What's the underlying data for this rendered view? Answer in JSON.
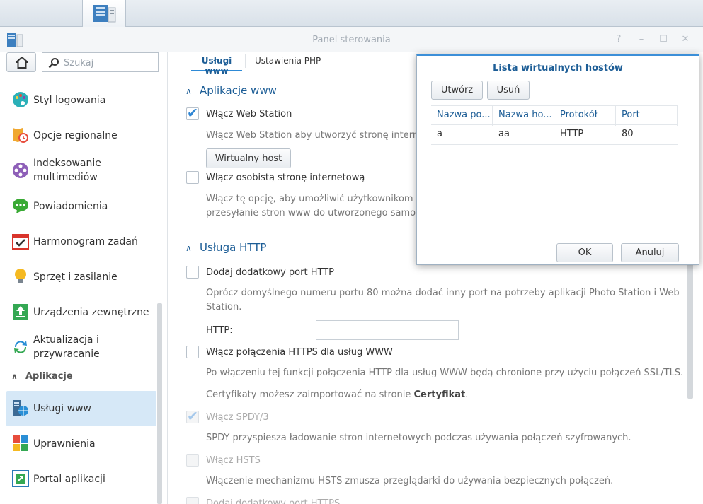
{
  "window": {
    "title": "Panel sterowania",
    "controls": [
      "?",
      "–",
      "☐",
      "✕"
    ]
  },
  "search": {
    "placeholder": "Szukaj"
  },
  "sidebar": {
    "items": [
      {
        "label": "Styl logowania",
        "icon": "palette-icon"
      },
      {
        "label": "Opcje regionalne",
        "icon": "regional-clock-icon"
      },
      {
        "label": "Indeksowanie\nmultimediów",
        "icon": "media-indexing-icon"
      },
      {
        "label": "Powiadomienia",
        "icon": "chat-bubble-icon"
      },
      {
        "label": "Harmonogram zadań",
        "icon": "calendar-check-icon"
      },
      {
        "label": "Sprzęt i zasilanie",
        "icon": "lightbulb-icon"
      },
      {
        "label": "Urządzenia zewnętrzne",
        "icon": "external-device-icon"
      },
      {
        "label": "Aktualizacja i\nprzywracanie",
        "icon": "update-restore-icon"
      }
    ],
    "section": "Aplikacje",
    "app_items": [
      {
        "label": "Usługi www",
        "icon": "web-services-icon",
        "active": true
      },
      {
        "label": "Uprawnienia",
        "icon": "privileges-icon"
      },
      {
        "label": "Portal aplikacji",
        "icon": "application-portal-icon"
      }
    ]
  },
  "tabs": [
    {
      "label": "Usługi www",
      "active": true
    },
    {
      "label": "Ustawienia PHP",
      "active": false
    }
  ],
  "web_apps": {
    "title": "Aplikacje www",
    "enable_web_station": "Włącz Web Station",
    "enable_web_station_desc": "Włącz Web Station aby utworzyć stronę internet",
    "virtual_host_button": "Wirtualny host",
    "enable_personal_site": "Włącz osobistą stronę internetową",
    "personal_site_desc_line1": "Włącz tę opcję, aby umożliwić użytkownikom loka",
    "personal_site_desc_line2": "przesyłanie stron www do utworzonego samodzi"
  },
  "http_service": {
    "title": "Usługa HTTP",
    "extra_port": "Dodaj dodatkowy port HTTP",
    "extra_port_desc_line1": "Oprócz domyślnego numeru portu 80 można dodać inny port na potrzeby aplikacji Photo Station i Web",
    "extra_port_desc_line2": "Station.",
    "http_label": "HTTP:",
    "http_value": "",
    "https": "Włącz połączenia HTTPS dla usług WWW",
    "https_desc": "Po włączeniu tej funkcji połączenia HTTP dla usług WWW będą chronione przy użyciu połączeń SSL/TLS.",
    "cert_desc_prefix": "Certyfikaty możesz zaimportować na stronie ",
    "cert_desc_link": "Certyfikat",
    "cert_desc_suffix": ".",
    "spdy": "Włącz SPDY/3",
    "spdy_desc": "SPDY przyspiesza ładowanie stron internetowych podczas używania połączeń szyfrowanych.",
    "hsts": "Włącz HSTS",
    "hsts_desc": "Włączenie mechanizmu HSTS zmusza przeglądarki do używania bezpiecznych połączeń.",
    "extra_https_port": "Dodaj dodatkowy port HTTPS"
  },
  "modal": {
    "title": "Lista wirtualnych hostów",
    "create_button": "Utwórz",
    "delete_button": "Usuń",
    "columns": [
      "Nazwa po...",
      "Nazwa ho...",
      "Protokół",
      "Port"
    ],
    "rows": [
      [
        "a",
        "aa",
        "HTTP",
        "80"
      ]
    ],
    "ok_button": "OK",
    "cancel_button": "Anuluj"
  },
  "colors": {
    "accent": "#2e8ad6",
    "title_blue": "#1c5d96",
    "active_bg": "#d6e8f7"
  }
}
